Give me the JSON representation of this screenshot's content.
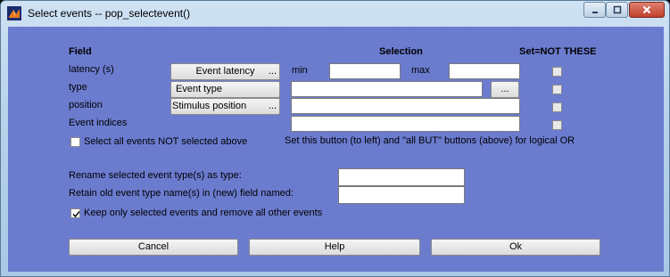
{
  "window": {
    "title": "Select events -- pop_selectevent()",
    "app_icon": "matlab-icon"
  },
  "header": {
    "field": "Field",
    "selection": "Selection",
    "set_not_these": "Set=NOT THESE"
  },
  "rows": {
    "latency": {
      "label": "latency (s)",
      "button": "Event latency",
      "dots": "...",
      "min_label": "min",
      "max_label": "max",
      "min_value": "",
      "max_value": ""
    },
    "type": {
      "label": "type",
      "button": "Event type",
      "dots": "...",
      "value": ""
    },
    "position": {
      "label": "position",
      "button": "Stimulus position",
      "dots": "...",
      "value": ""
    },
    "indices": {
      "label": "Event indices",
      "value": ""
    }
  },
  "select_not_selected": {
    "label": "Select all events NOT selected above",
    "checked": false
  },
  "hint": "Set this button (to left) and \"all BUT\" buttons (above) for logical OR",
  "rename": {
    "label": "Rename selected event type(s) as type:",
    "value": ""
  },
  "retain": {
    "label": "Retain old event type name(s) in (new) field named:",
    "value": ""
  },
  "keep_only": {
    "label": "Keep only selected events and remove all other events",
    "checked": true
  },
  "buttons": {
    "cancel": "Cancel",
    "help": "Help",
    "ok": "Ok"
  },
  "colors": {
    "background": "#6b7ccf"
  }
}
